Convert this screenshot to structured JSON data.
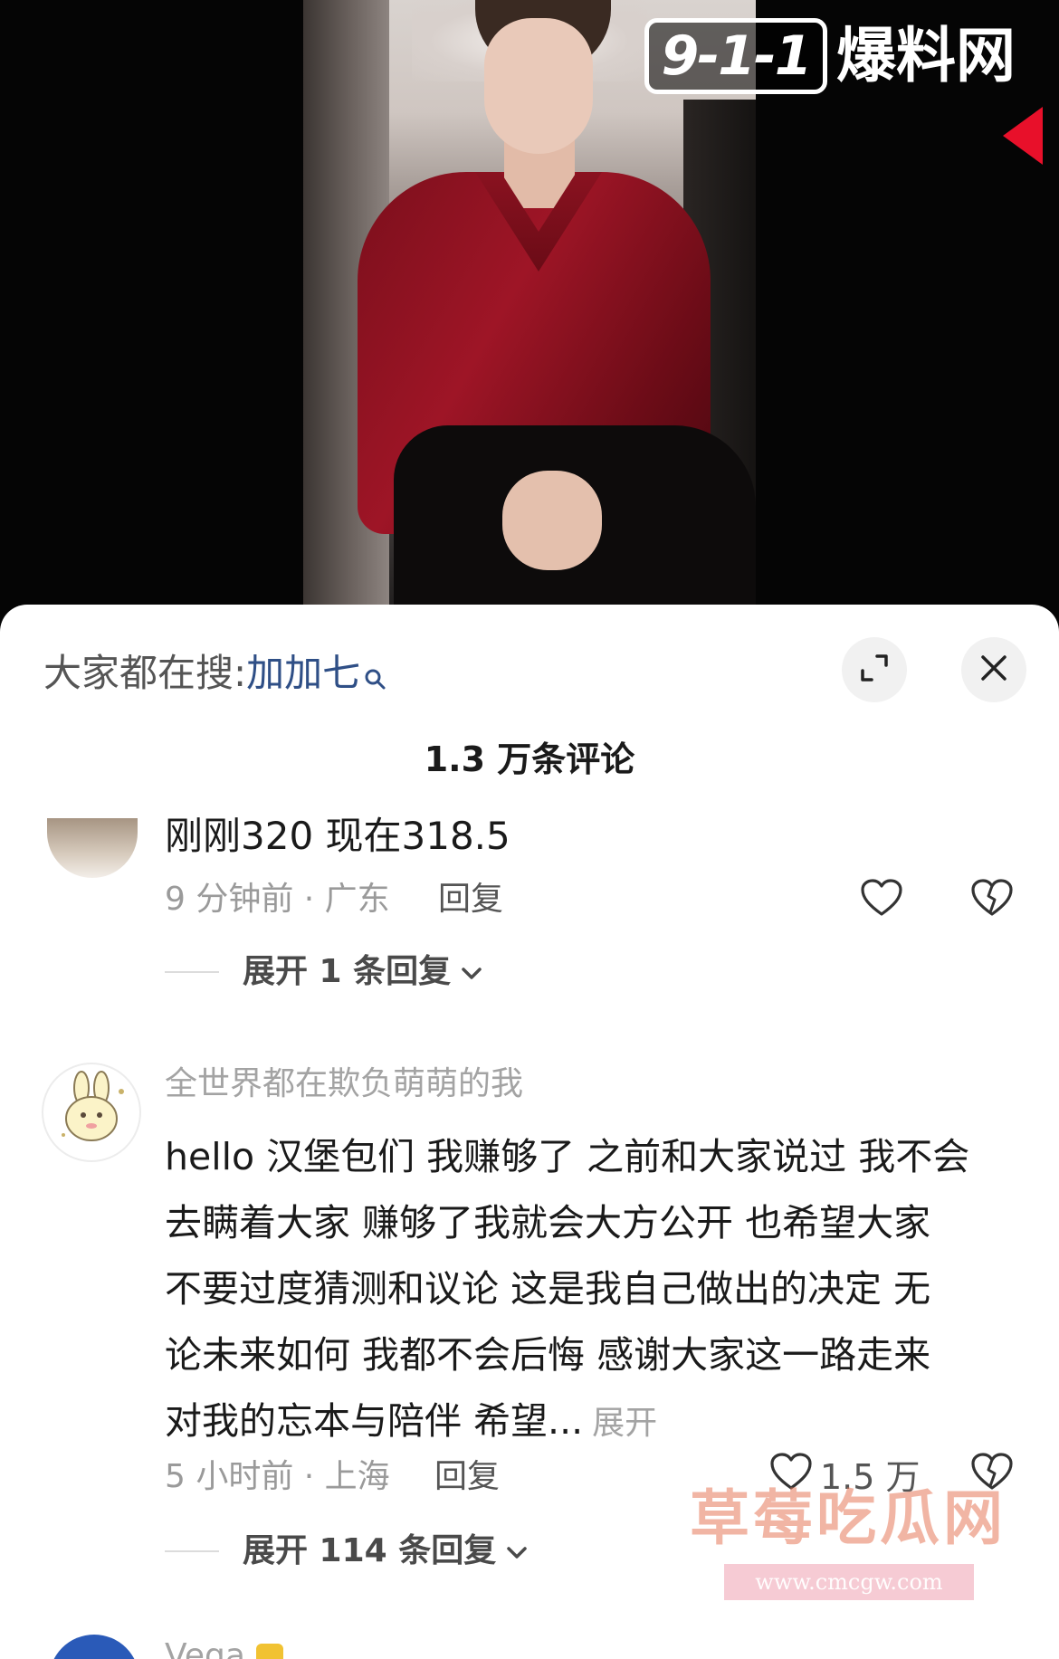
{
  "video": {
    "watermark_logo_number": "9-1-1",
    "watermark_logo_text": "爆料网"
  },
  "sheet": {
    "search_hint_prefix": "大家都在搜:",
    "search_hint_term": "加加七",
    "comment_count": "1.3 万条评论"
  },
  "comments": [
    {
      "text": "刚刚320 现在318.5",
      "meta": "9 分钟前 · 广东",
      "reply_label": "回复",
      "expand_label": "展开 1 条回复"
    },
    {
      "username": "全世界都在欺负萌萌的我",
      "lines": [
        "hello 汉堡包们 我赚够了 之前和大家说过 我不会",
        "去瞒着大家 赚够了我就会大方公开 也希望大家",
        "不要过度猜测和议论 这是我自己做出的决定 无",
        "论未来如何 我都不会后悔 感谢大家这一路走来",
        "对我的忘本与陪伴 希望..."
      ],
      "more_label": "展开",
      "meta": "5 小时前 · 上海",
      "reply_label": "回复",
      "like_count": "1.5 万",
      "expand_label": "展开 114 条回复"
    },
    {
      "username": "Vega"
    }
  ],
  "watermarks": {
    "caomei": "草莓吃瓜网",
    "url": "www.cmcgw.com"
  },
  "icons": {
    "search_term": "search-icon",
    "expand": "expand-icon",
    "close": "close-icon",
    "like": "heart-icon",
    "dislike": "broken-heart-icon",
    "chevron": "chevron-down-icon"
  },
  "colors": {
    "link_blue": "#2f4f86",
    "shirt_red": "#9e1526",
    "arrow_red": "#e8102a"
  }
}
